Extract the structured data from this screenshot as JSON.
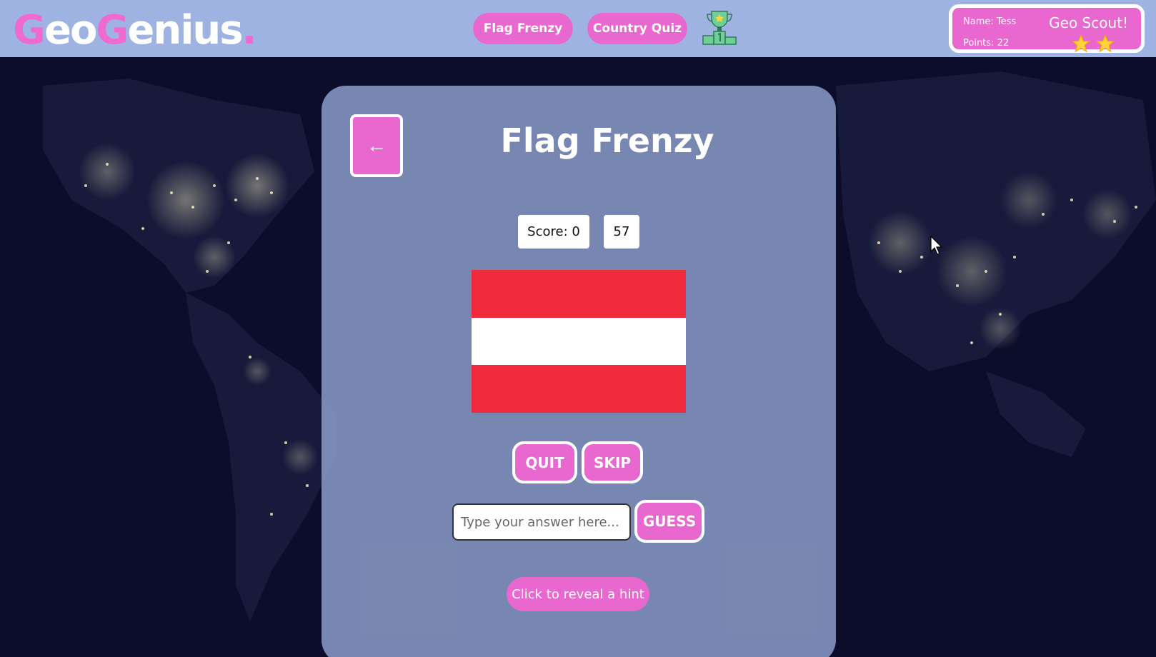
{
  "header": {
    "logo": {
      "part1": "G",
      "part2": "eo",
      "part3": "G",
      "part4": "enius",
      "part5": "."
    },
    "nav": [
      {
        "label": "Flag Frenzy"
      },
      {
        "label": "Country Quiz"
      }
    ],
    "leaderboard_icon": "trophy-podium-icon"
  },
  "profile": {
    "name": "Name: Tess",
    "points": "Points: 22",
    "rank": "Geo Scout!",
    "stars": 2
  },
  "game": {
    "back_label": "←",
    "title": "Flag Frenzy",
    "score": "Score: 0",
    "timer": "57",
    "flag": {
      "stripes": [
        "#ee2a3c",
        "#ffffff",
        "#ee2a3c"
      ]
    },
    "quit_label": "QUIT",
    "skip_label": "SKIP",
    "answer_value": "",
    "answer_placeholder": "Type your answer here...",
    "guess_label": "GUESS",
    "hint_label": "Click to reveal a hint"
  },
  "colors": {
    "accent": "#e868cf",
    "header_bg": "#9eb3e2",
    "panel_bg": "#96aad7",
    "map_bg": "#0c0d2b"
  }
}
